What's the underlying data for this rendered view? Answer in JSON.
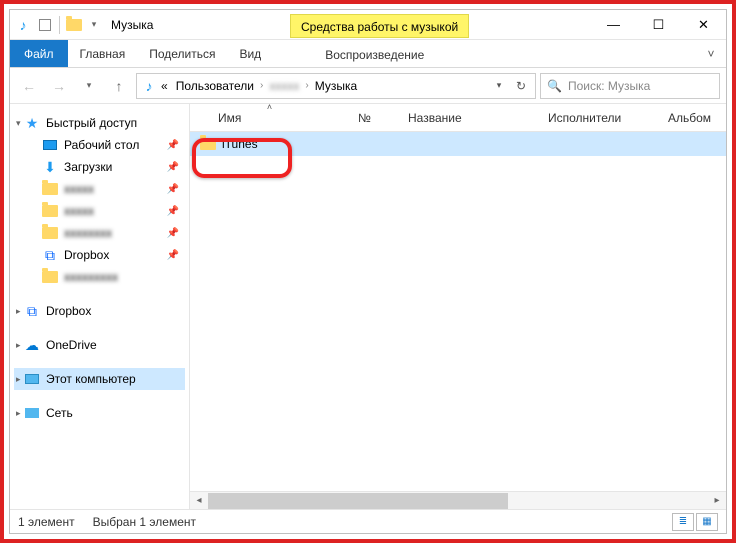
{
  "window": {
    "title": "Музыка",
    "context_tools_label": "Средства работы с музыкой"
  },
  "ribbon": {
    "file": "Файл",
    "tabs": [
      "Главная",
      "Поделиться",
      "Вид"
    ],
    "context_tab": "Воспроизведение"
  },
  "breadcrumbs": {
    "prefix": "«",
    "items": [
      "Пользователи",
      "",
      "Музыка"
    ]
  },
  "search": {
    "placeholder": "Поиск: Музыка"
  },
  "sidebar": {
    "quick_access": "Быстрый доступ",
    "desktop": "Рабочий стол",
    "downloads": "Загрузки",
    "blurred": [
      "",
      "",
      "",
      ""
    ],
    "dropbox_pinned": "Dropbox",
    "dropbox": "Dropbox",
    "onedrive": "OneDrive",
    "this_pc": "Этот компьютер",
    "network": "Сеть"
  },
  "columns": {
    "name": "Имя",
    "number": "№",
    "title": "Название",
    "artists": "Исполнители",
    "album": "Альбом"
  },
  "items": [
    {
      "name": "iTunes",
      "type": "folder"
    }
  ],
  "status": {
    "count_label": "1 элемент",
    "selection_label": "Выбран 1 элемент"
  }
}
